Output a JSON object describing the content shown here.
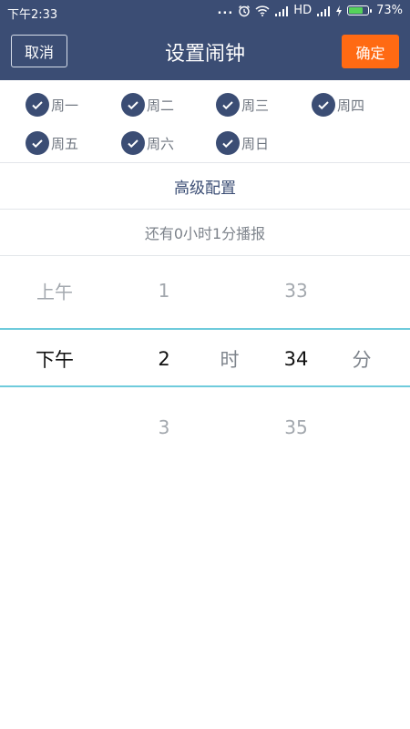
{
  "status_bar": {
    "time": "下午2:33",
    "dots": "...",
    "network": "HD",
    "battery_percent": "73%",
    "battery_level": 0.73,
    "icons": [
      "alarm-icon",
      "wifi-icon",
      "signal-icon",
      "signal-icon",
      "charging-icon",
      "battery-icon"
    ]
  },
  "header": {
    "cancel_label": "取消",
    "title": "设置闹钟",
    "confirm_label": "确定"
  },
  "days": [
    {
      "label": "周一",
      "checked": true
    },
    {
      "label": "周二",
      "checked": true
    },
    {
      "label": "周三",
      "checked": true
    },
    {
      "label": "周四",
      "checked": true
    },
    {
      "label": "周五",
      "checked": true
    },
    {
      "label": "周六",
      "checked": true
    },
    {
      "label": "周日",
      "checked": true
    }
  ],
  "advanced_label": "高级配置",
  "remaining_label": "还有0小时1分播报",
  "picker": {
    "ampm": {
      "above": "上午",
      "selected": "下午",
      "below": ""
    },
    "hour": {
      "above": "1",
      "selected": "2",
      "below": "3"
    },
    "hour_unit": "时",
    "minute": {
      "above": "33",
      "selected": "34",
      "below": "35"
    },
    "minute_unit": "分"
  },
  "colors": {
    "primary": "#3b4d74",
    "accent": "#ff6a13",
    "selection_line": "#6fcbdc"
  }
}
